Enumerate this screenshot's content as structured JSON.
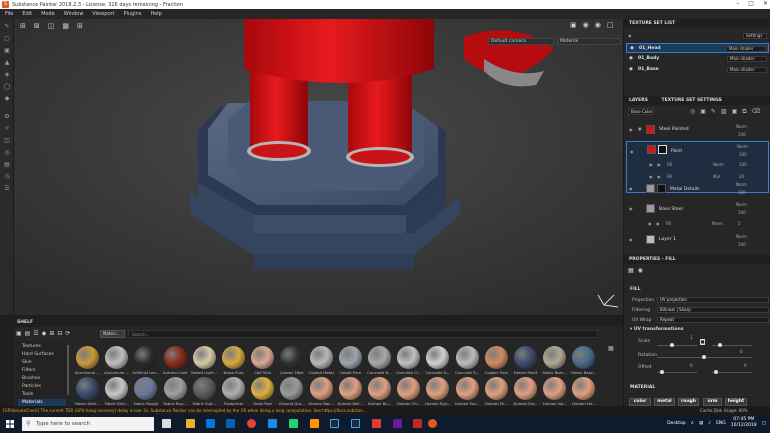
{
  "title": "Substance Painter 2018.2.3 - License: 316 days remaining - Fraction",
  "menu": [
    "File",
    "Edit",
    "Mode",
    "Window",
    "Viewport",
    "Plugins",
    "Help"
  ],
  "viewport": {
    "camera_select": "Default camera",
    "channel_select": "Material"
  },
  "texture_set_list": {
    "title": "TEXTURE SET LIST",
    "settings_label": "Settings",
    "sets": [
      {
        "name": "01_Head",
        "shader": "Main shader"
      },
      {
        "name": "01_Body",
        "shader": "Main shader"
      },
      {
        "name": "01_Base",
        "shader": "Main shader"
      }
    ]
  },
  "layers": {
    "tab_layers": "LAYERS",
    "tab_texture_set_settings": "TEXTURE SET SETTINGS",
    "channel": "Base Color",
    "items": [
      {
        "name": "Steel Painted",
        "blend": "Norm",
        "opacity": "100",
        "thumb": "#c8161c"
      },
      {
        "name": "Paint",
        "blend": "Norm",
        "opacity": "100",
        "thumb": "#d01515"
      },
      {
        "name": "Fill",
        "blend": "Norm",
        "opacity": "100",
        "thumb": "#6e6e6e"
      },
      {
        "name": "Fill",
        "blend": "Mul",
        "opacity": "20",
        "thumb": "#8a8a8a"
      },
      {
        "name": "Metal Details",
        "blend": "Norm",
        "opacity": "100",
        "thumb": "#111111"
      },
      {
        "name": "Base Steel",
        "blend": "Norm",
        "opacity": "100",
        "thumb": "#9a9a9a"
      },
      {
        "name": "Fill",
        "blend": "Norm",
        "opacity": "5",
        "thumb": "#777777"
      },
      {
        "name": "Layer 1",
        "blend": "Norm",
        "opacity": "100",
        "thumb": "#bbbbbb"
      }
    ]
  },
  "properties": {
    "title": "PROPERTIES - FILL",
    "section_fill": "FILL",
    "projection_label": "Projection",
    "projection_value": "UV projection",
    "filtering_label": "Filtering",
    "filtering_value": "Bilinear | Sharp",
    "uvwrap_label": "UV Wrap",
    "uvwrap_value": "Repeat",
    "uv_transform_title": "UV transformations",
    "scale_label": "Scale",
    "scale_value": "1",
    "rotation_label": "Rotation",
    "rotation_value": "0",
    "offset_label": "Offset",
    "offset_value": "0",
    "offset_value2": "0",
    "material_title": "MATERIAL",
    "material_buttons": [
      "color",
      "metal",
      "rough",
      "nrm",
      "height"
    ]
  },
  "shelf": {
    "title": "SHELF",
    "filter_tag": "Materi...",
    "search_placeholder": "Search...",
    "categories": [
      "Textures",
      "Hard Surfaces",
      "Skin",
      "Filters",
      "Brushes",
      "Particles",
      "Tools",
      "Materials"
    ],
    "materials_row1": [
      {
        "name": "Aluminium ...",
        "color": "#c89a3a"
      },
      {
        "name": "Aluminium ...",
        "color": "#bfbfbf"
      },
      {
        "name": "Artificial Lea...",
        "color": "#2a2a2a"
      },
      {
        "name": "Autumn Leaf",
        "color": "#8a2a1a"
      },
      {
        "name": "Baked Light...",
        "color": "#d8c8a8"
      },
      {
        "name": "Brass Pure",
        "color": "#d4a843"
      },
      {
        "name": "Calf Skin",
        "color": "#d8a890"
      },
      {
        "name": "Carbon Fiber",
        "color": "#303030"
      },
      {
        "name": "Coated Metal",
        "color": "#b8b8b8"
      },
      {
        "name": "Cobalt Pure",
        "color": "#9ea4ad"
      },
      {
        "name": "Concrete B...",
        "color": "#a8a8a8"
      },
      {
        "name": "Concrete Cl...",
        "color": "#c0c0c0"
      },
      {
        "name": "Concrete D...",
        "color": "#d0d0d0"
      },
      {
        "name": "Concrete S...",
        "color": "#bcbcbc"
      },
      {
        "name": "Copper Pure",
        "color": "#d08a60"
      },
      {
        "name": "Denim Rivet",
        "color": "#3a4a6a"
      },
      {
        "name": "Fabric Bam...",
        "color": "#b0a890"
      },
      {
        "name": "Fabric Base...",
        "color": "#4a6a8a"
      }
    ],
    "materials_row2": [
      {
        "name": "Fabric Deni...",
        "color": "#3a4a6a"
      },
      {
        "name": "Fabric Knit...",
        "color": "#c8c8c8"
      },
      {
        "name": "Fabric Rough",
        "color": "#6a7a9a"
      },
      {
        "name": "Fabric Rou...",
        "color": "#a0a0a0"
      },
      {
        "name": "Fabric Suit...",
        "color": "#5a5a5a"
      },
      {
        "name": "Footprints",
        "color": "#b0b0b0"
      },
      {
        "name": "Gold Pure",
        "color": "#e0b040"
      },
      {
        "name": "Ground Gra...",
        "color": "#9a9a9a"
      },
      {
        "name": "Human Bac...",
        "color": "#e0a080"
      },
      {
        "name": "Human Bell...",
        "color": "#e0a080"
      },
      {
        "name": "Human Bu...",
        "color": "#e0a080"
      },
      {
        "name": "Human Ch...",
        "color": "#e0a080"
      },
      {
        "name": "Human Eye...",
        "color": "#e0a080"
      },
      {
        "name": "Human Fac...",
        "color": "#e0a080"
      },
      {
        "name": "Human Fe...",
        "color": "#e0a080"
      },
      {
        "name": "Human For...",
        "color": "#e0a080"
      },
      {
        "name": "Human Ha...",
        "color": "#e0a080"
      },
      {
        "name": "Human He...",
        "color": "#e0a080"
      }
    ]
  },
  "status": {
    "message": "[GPUIssuesCheck] The current TDR (GPU hang recovery) delay is low: 2s. Substance Painter can be interrupted by the OS when doing a long computation. See https://docs.substan...",
    "cache_label": "Cache Disk Usage:",
    "cache_value": "60%"
  },
  "taskbar": {
    "search_placeholder": "Type here to search",
    "desktop_label": "Desktop",
    "lang": "ENG",
    "time": "07:45 PM",
    "date": "10/12/2018"
  },
  "colors": {
    "accent": "#2f7fd8",
    "selected_row": "#1e3a5a",
    "brand": "#e05a1f",
    "status_warn": "#e0a43a"
  }
}
